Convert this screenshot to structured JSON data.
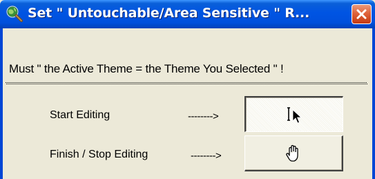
{
  "window": {
    "title": "Set \" Untouchable/Area Sensitive \" R...",
    "app_icon": "globe-magnifier-icon",
    "close_icon": "close-icon"
  },
  "dialog": {
    "message": "Must \" the Active Theme  =  the Theme You Selected \" !"
  },
  "rows": [
    {
      "label": "Start Editing",
      "arrow": "-------->",
      "button_icon": "text-cursor-pointer-icon",
      "pressed": true
    },
    {
      "label": "Finish / Stop Editing",
      "arrow": "-------->",
      "button_icon": "hand-pan-icon",
      "pressed": false
    }
  ],
  "colors": {
    "titlebar": "#0054e3",
    "dialog_bg": "#ece9d8",
    "close_button": "#e0643c"
  }
}
